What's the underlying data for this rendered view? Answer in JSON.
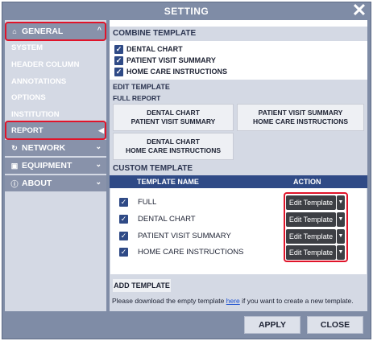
{
  "window": {
    "title": "SETTING",
    "close_glyph": "✕"
  },
  "sidebar": {
    "general": {
      "label": "GENERAL",
      "icon": "home-icon",
      "chevron": "^"
    },
    "sub_items": [
      {
        "label": "SYSTEM"
      },
      {
        "label": "HEADER COLUMN"
      },
      {
        "label": "ANNOTATIONS"
      },
      {
        "label": "OPTIONS"
      },
      {
        "label": "INSTITUTION"
      },
      {
        "label": "REPORT",
        "active": true
      }
    ],
    "network": {
      "label": "NETWORK",
      "icon": "network-icon"
    },
    "equipment": {
      "label": "EQUIPMENT",
      "icon": "equipment-icon"
    },
    "about": {
      "label": "ABOUT",
      "icon": "info-icon"
    }
  },
  "combine_template": {
    "title": "COMBINE TEMPLATE",
    "items": [
      {
        "label": "DENTAL CHART",
        "checked": true
      },
      {
        "label": "PATIENT VISIT SUMMARY",
        "checked": true
      },
      {
        "label": "HOME CARE INSTRUCTIONS",
        "checked": true
      }
    ]
  },
  "edit_template": {
    "title": "EDIT TEMPLATE",
    "subtitle": "FULL REPORT",
    "buttons": [
      {
        "line1": "DENTAL CHART",
        "line2": "PATIENT VISIT SUMMARY"
      },
      {
        "line1": "PATIENT VISIT SUMMARY",
        "line2": "HOME CARE INSTRUCTIONS"
      },
      {
        "line1": "DENTAL CHART",
        "line2": "HOME CARE INSTRUCTIONS"
      }
    ]
  },
  "custom_template": {
    "title": "CUSTOM TEMPLATE",
    "columns": {
      "name": "TEMPLATE NAME",
      "action": "ACTION"
    },
    "rows": [
      {
        "name": "FULL",
        "checked": true,
        "action": "Edit Template"
      },
      {
        "name": "DENTAL CHART",
        "checked": true,
        "action": "Edit Template"
      },
      {
        "name": "PATIENT VISIT SUMMARY",
        "checked": true,
        "action": "Edit Template"
      },
      {
        "name": "HOME CARE INSTRUCTIONS",
        "checked": true,
        "action": "Edit Template"
      }
    ],
    "add_button": "ADD TEMPLATE",
    "note_before": "Please download the empty template ",
    "note_link": "here",
    "note_after": " if you want to create a new template."
  },
  "footer": {
    "apply": "APPLY",
    "close": "CLOSE"
  },
  "colors": {
    "accent": "#2f4a86",
    "highlight": "#e0142a",
    "nav": "#8892aa",
    "panel": "#d4d9e4"
  }
}
